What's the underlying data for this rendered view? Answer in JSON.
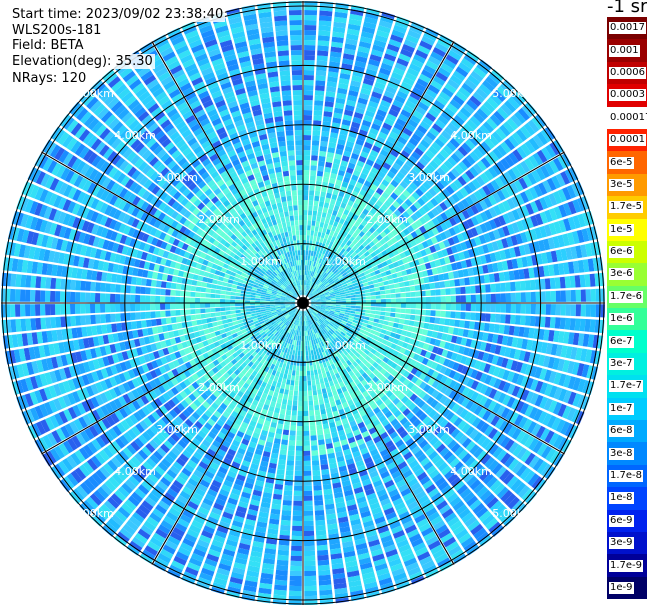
{
  "info": {
    "start_time": "Start time: 2023/09/02 23:38:40",
    "instrument": "WLS200s-181",
    "field": "Field: BETA",
    "elevation": "Elevation(deg): 35.30",
    "nrays": "NRays: 120"
  },
  "ring_labels": [
    "1.00km",
    "2.00km",
    "3.00km",
    "4.00km",
    "5.00km"
  ],
  "colorbar": {
    "title": "-1 sr",
    "levels": [
      {
        "label": "0.0017",
        "color": "#7a0000"
      },
      {
        "label": "0.001",
        "color": "#9a0000"
      },
      {
        "label": "0.0006",
        "color": "#c00000"
      },
      {
        "label": "0.0003",
        "color": "#e00000"
      },
      {
        "label": "0.00017",
        "color": "#ffffff"
      },
      {
        "label": "0.0001",
        "color": "#ff2200"
      },
      {
        "label": "6e-5",
        "color": "#ff6600"
      },
      {
        "label": "3e-5",
        "color": "#ff9a00"
      },
      {
        "label": "1.7e-5",
        "color": "#ffcc00"
      },
      {
        "label": "1e-5",
        "color": "#ffff00"
      },
      {
        "label": "6e-6",
        "color": "#ccff00"
      },
      {
        "label": "3e-6",
        "color": "#99ff33"
      },
      {
        "label": "1.7e-6",
        "color": "#66ff66"
      },
      {
        "label": "1e-6",
        "color": "#33ff99"
      },
      {
        "label": "6e-7",
        "color": "#00ffcc"
      },
      {
        "label": "3e-7",
        "color": "#00f0e0"
      },
      {
        "label": "1.7e-7",
        "color": "#00e0f0"
      },
      {
        "label": "1e-7",
        "color": "#00ccff"
      },
      {
        "label": "6e-8",
        "color": "#00aaff"
      },
      {
        "label": "3e-8",
        "color": "#0088ff"
      },
      {
        "label": "1.7e-8",
        "color": "#0066ff"
      },
      {
        "label": "1e-8",
        "color": "#0044ff"
      },
      {
        "label": "6e-9",
        "color": "#0022ee"
      },
      {
        "label": "3e-9",
        "color": "#0011cc"
      },
      {
        "label": "1.7e-9",
        "color": "#000099"
      },
      {
        "label": "1e-9",
        "color": "#000066"
      }
    ]
  },
  "colors": {
    "near_field": [
      "#30ddee",
      "#22c8f0",
      "#66ffdd",
      "#3ad6ee",
      "#28b8f4"
    ],
    "mid_field": [
      "#5af7e4",
      "#4ef0e8",
      "#3ce6f0",
      "#66ffd8"
    ],
    "far_field": [
      "#22bbff",
      "#1fa6ff",
      "#2ccfff",
      "#34e0f6",
      "#1a8cff",
      "#3ac8ff",
      "#2860ee",
      "#30d8f8"
    ]
  }
}
